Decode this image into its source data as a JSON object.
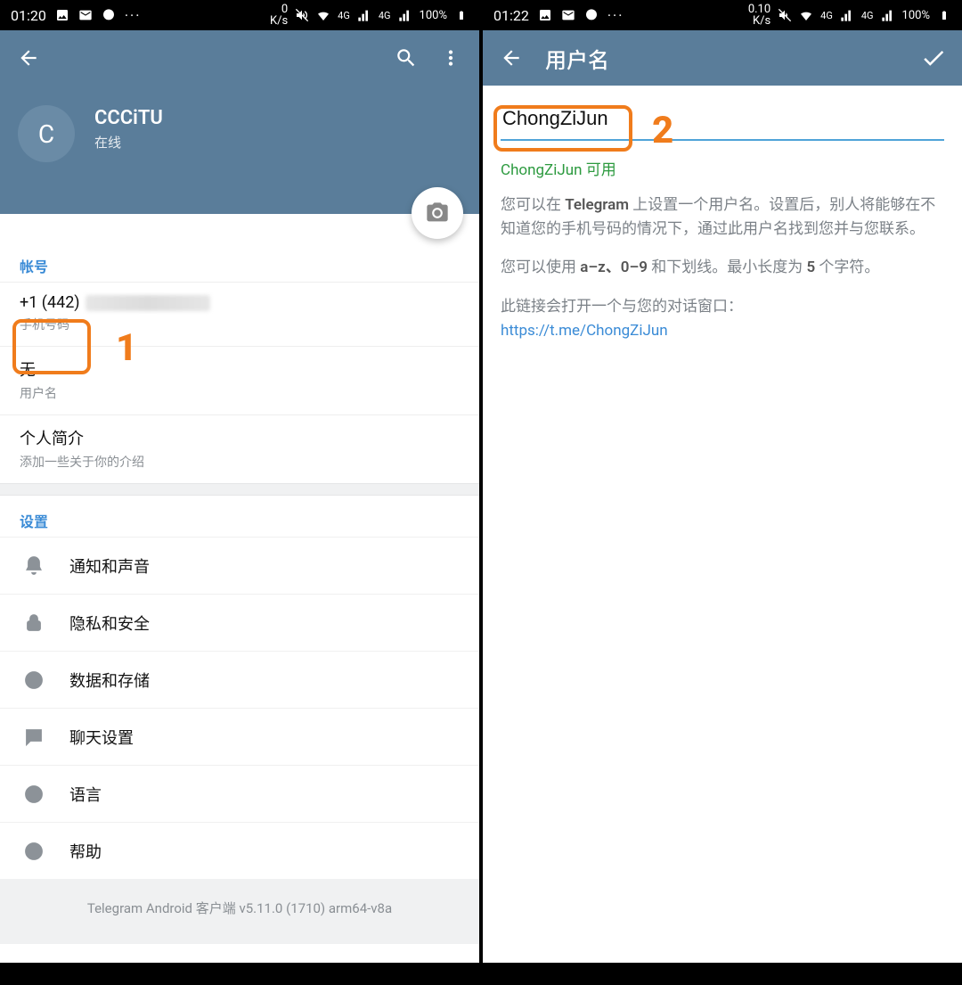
{
  "left": {
    "statusbar": {
      "time": "01:20",
      "speed": "0\nK/s",
      "net": "4G",
      "battery": "100%"
    },
    "profile": {
      "avatar_letter": "C",
      "name": "CCCiTU",
      "status": "在线"
    },
    "account": {
      "section_title": "帐号",
      "phone_prefix": "+1 (442)",
      "phone_label": "手机号码",
      "username_value": "无",
      "username_label": "用户名",
      "bio_value": "个人简介",
      "bio_label": "添加一些关于你的介绍"
    },
    "settings": {
      "section_title": "设置",
      "items": [
        {
          "label": "通知和声音"
        },
        {
          "label": "隐私和安全"
        },
        {
          "label": "数据和存储"
        },
        {
          "label": "聊天设置"
        },
        {
          "label": "语言"
        },
        {
          "label": "帮助"
        }
      ]
    },
    "footer": "Telegram Android 客户端 v5.11.0 (1710) arm64-v8a",
    "annotation": {
      "number": "1"
    }
  },
  "right": {
    "statusbar": {
      "time": "01:22",
      "speed": "0.10\nK/s",
      "net": "4G",
      "battery": "100%"
    },
    "toolbar": {
      "title": "用户名"
    },
    "username_value": "ChongZiJun",
    "avail_text": "ChongZiJun 可用",
    "help1_a": "您可以在 ",
    "help1_b": "Telegram",
    "help1_c": " 上设置一个用户名。设置后，别人将能够在不知道您的手机号码的情况下，通过此用户名找到您并与您联系。",
    "help2_a": "您可以使用 ",
    "help2_b": "a–z、0–9",
    "help2_c": " 和下划线。最小长度为 ",
    "help2_d": "5",
    "help2_e": " 个字符。",
    "help3": "此链接会打开一个与您的对话窗口：",
    "link": "https://t.me/ChongZiJun",
    "annotation": {
      "number": "2"
    }
  }
}
